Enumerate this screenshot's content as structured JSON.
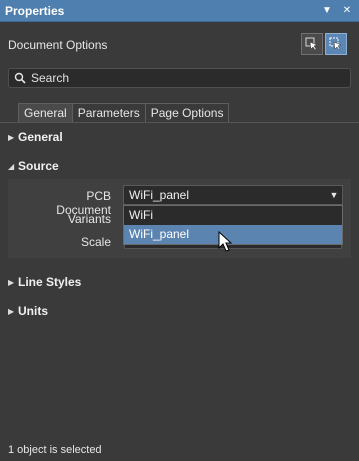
{
  "panel": {
    "title": "Properties",
    "pin_icon": "pin-dropdown-icon",
    "close_icon": "close-icon"
  },
  "header": {
    "label": "Document Options",
    "filter_buttons": [
      "select-filter-icon",
      "selection-cursor-icon"
    ]
  },
  "search": {
    "placeholder": "Search"
  },
  "tabs": [
    {
      "label": "General",
      "active": true
    },
    {
      "label": "Parameters",
      "active": false
    },
    {
      "label": "Page Options",
      "active": false
    }
  ],
  "sections": {
    "general": "General",
    "source": "Source",
    "line_styles": "Line Styles",
    "units": "Units"
  },
  "source": {
    "pcb_document_label": "PCB Document",
    "pcb_document_value": "WiFi_panel",
    "variants_label": "Variants",
    "scale_label": "Scale",
    "dropdown_options": [
      "WiFi",
      "WiFi_panel"
    ],
    "highlighted_option": "WiFi_panel"
  },
  "status": {
    "text": "1 object is selected"
  },
  "colors": {
    "title_bar": "#4f7fae",
    "highlight": "#5b85b0",
    "background": "#3a3a3a"
  }
}
